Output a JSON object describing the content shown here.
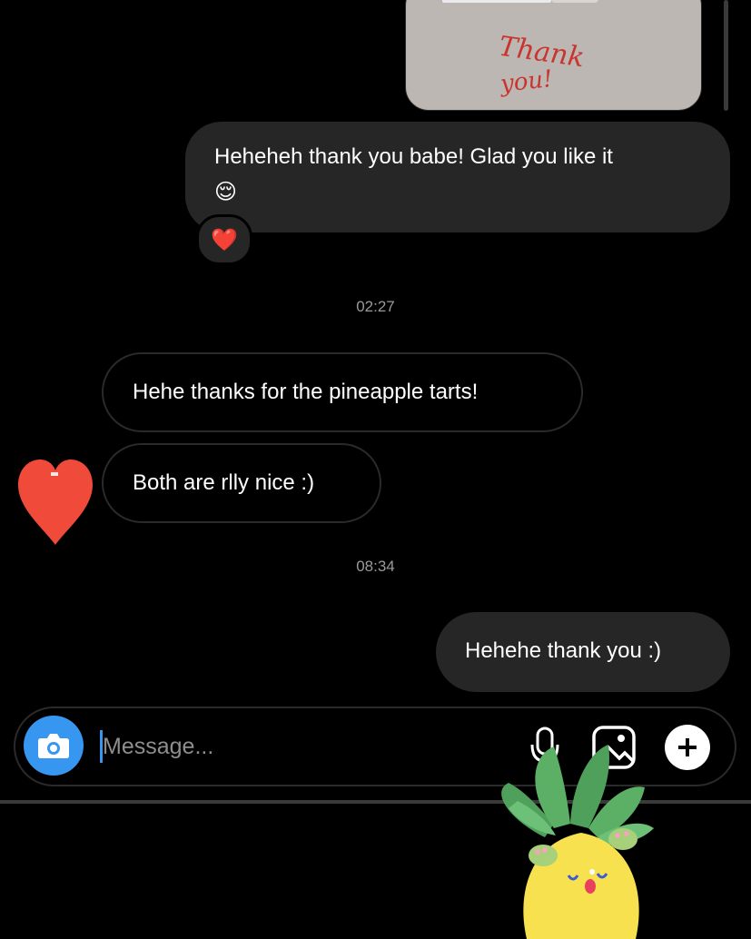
{
  "top_image": {
    "handwriting_line1": "Thank",
    "handwriting_line2": "you!"
  },
  "messages": [
    {
      "id": "m1",
      "direction": "out",
      "text": "Heheheh thank you babe! Glad you like it",
      "emoji": "😌",
      "reaction": "❤️"
    },
    {
      "id": "ts1",
      "type": "timestamp",
      "text": "02:27"
    },
    {
      "id": "m2",
      "direction": "in",
      "text": "Hehe thanks for the pineapple tarts!"
    },
    {
      "id": "m3",
      "direction": "in",
      "text": "Both are rlly nice :)"
    },
    {
      "id": "ts2",
      "type": "timestamp",
      "text": "08:34"
    },
    {
      "id": "m4",
      "direction": "out",
      "text": "Hehehe thank you :)"
    }
  ],
  "composer": {
    "placeholder": "Message...",
    "icons": [
      "camera-icon",
      "microphone-icon",
      "gallery-icon",
      "plus-icon"
    ]
  },
  "stickers": [
    "heart-sticker",
    "pineapple-sticker"
  ],
  "colors": {
    "background": "#000000",
    "outgoing_bubble": "#262626",
    "accent_blue": "#3797f0",
    "heart_red": "#f04a3b",
    "timestamp": "#9a9a9a"
  }
}
